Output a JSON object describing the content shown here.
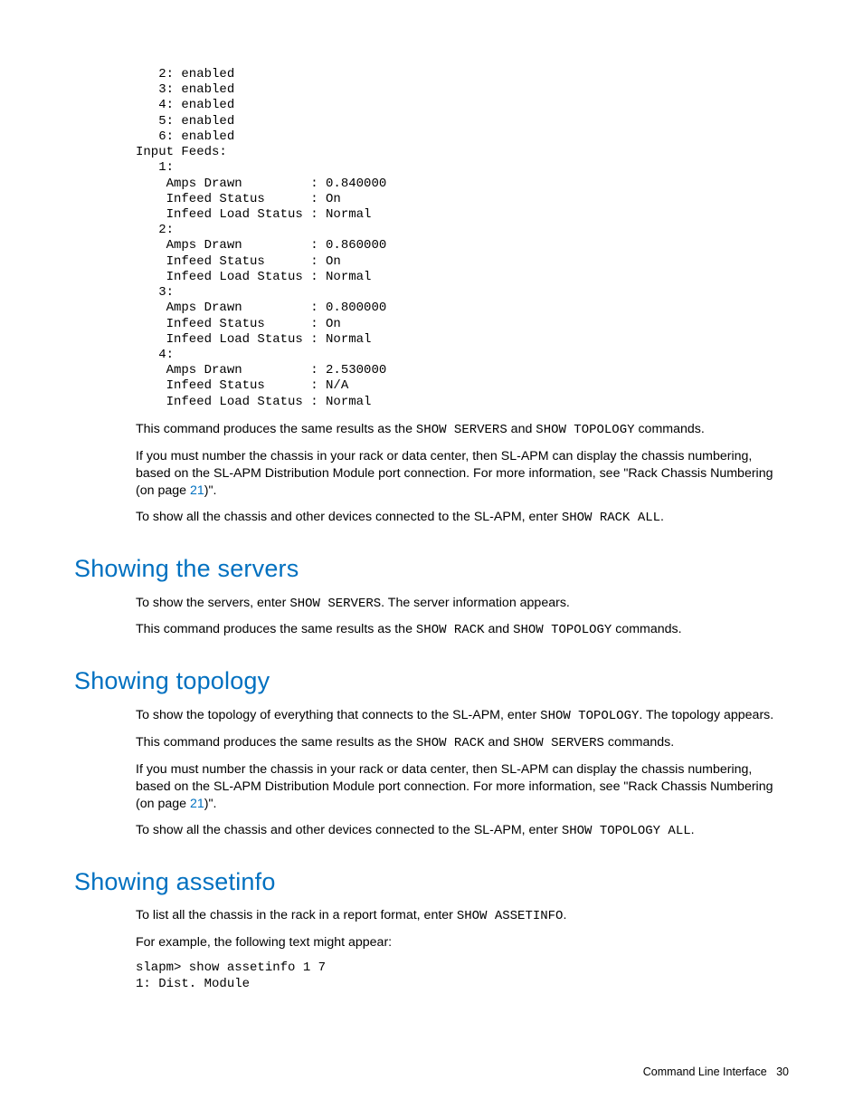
{
  "term1": "   2: enabled\n   3: enabled\n   4: enabled\n   5: enabled\n   6: enabled\nInput Feeds:\n   1:\n    Amps Drawn         : 0.840000\n    Infeed Status      : On\n    Infeed Load Status : Normal\n   2:\n    Amps Drawn         : 0.860000\n    Infeed Status      : On\n    Infeed Load Status : Normal\n   3:\n    Amps Drawn         : 0.800000\n    Infeed Status      : On\n    Infeed Load Status : Normal\n   4:\n    Amps Drawn         : 2.530000\n    Infeed Status      : N/A\n    Infeed Load Status : Normal",
  "p1a": "This command produces the same results as the ",
  "p1b": "SHOW SERVERS",
  "p1c": " and ",
  "p1d": "SHOW TOPOLOGY",
  "p1e": " commands.",
  "p2a": "If you must number the chassis in your rack or data center, then SL-APM can display the chassis numbering, based on the SL-APM Distribution Module port connection. For more information, see \"Rack Chassis Numbering (on page ",
  "p2link": "21",
  "p2b": ")\".",
  "p3a": "To show all the chassis and other devices connected to the SL-APM, enter ",
  "p3b": "SHOW RACK ALL",
  "p3c": ".",
  "h1": "Showing the servers",
  "p4a": "To show the servers, enter ",
  "p4b": "SHOW SERVERS",
  "p4c": ". The server information appears.",
  "p5a": "This command produces the same results as the ",
  "p5b": "SHOW RACK",
  "p5c": " and ",
  "p5d": "SHOW TOPOLOGY",
  "p5e": " commands.",
  "h2": "Showing topology",
  "p6a": "To show the topology of everything that connects to the SL-APM, enter ",
  "p6b": "SHOW TOPOLOGY",
  "p6c": ". The topology appears.",
  "p7a": "This command produces the same results as the ",
  "p7b": "SHOW RACK",
  "p7c": " and ",
  "p7d": "SHOW SERVERS",
  "p7e": " commands.",
  "p8a": "If you must number the chassis in your rack or data center, then SL-APM can display the chassis numbering, based on the SL-APM Distribution Module port connection. For more information, see \"Rack Chassis Numbering (on page ",
  "p8link": "21",
  "p8b": ")\".",
  "p9a": "To show all the chassis and other devices connected to the SL-APM, enter ",
  "p9b": "SHOW TOPOLOGY ALL",
  "p9c": ".",
  "h3": "Showing assetinfo",
  "p10a": "To list all the chassis in the rack in a report format, enter ",
  "p10b": "SHOW ASSETINFO",
  "p10c": ".",
  "p11": "For example, the following text might appear:",
  "term2": "slapm> show assetinfo 1 7\n1: Dist. Module",
  "footerText": "Command Line Interface",
  "footerPage": "30"
}
